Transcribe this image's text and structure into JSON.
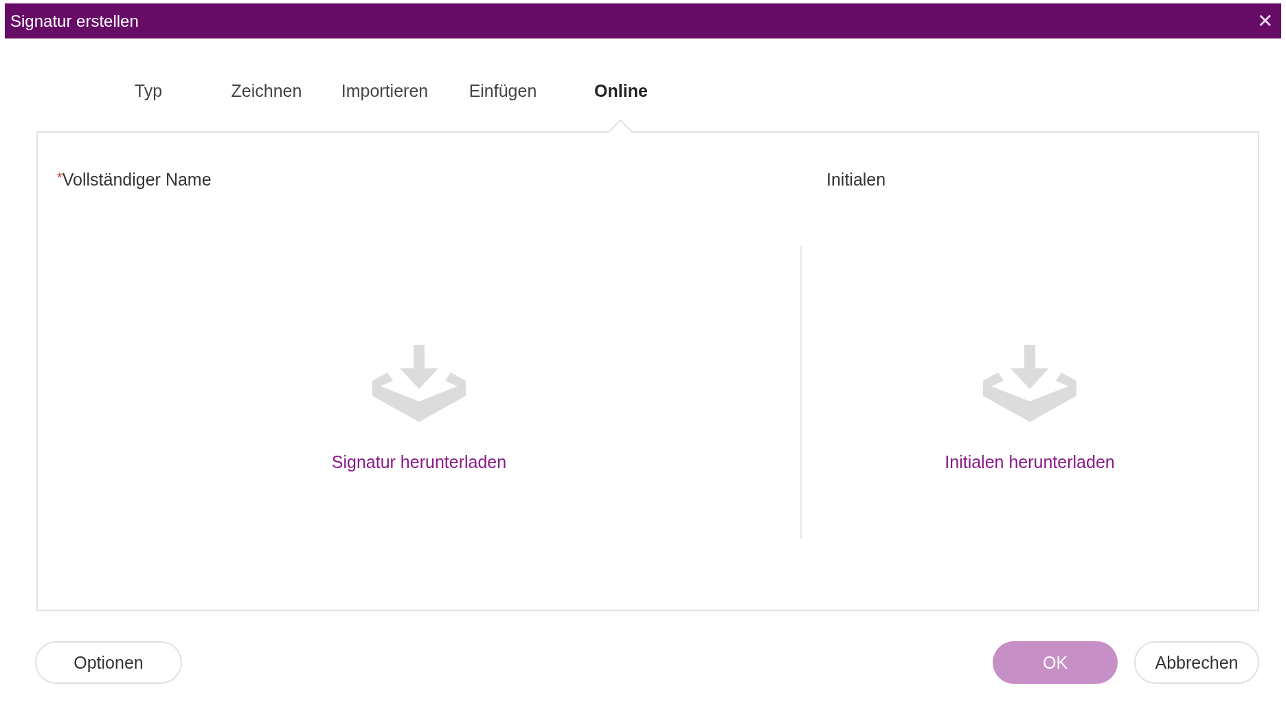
{
  "window": {
    "title": "Signatur erstellen",
    "close": "✕"
  },
  "tabs": [
    {
      "label": "Typ",
      "selected": false
    },
    {
      "label": "Zeichnen",
      "selected": false
    },
    {
      "label": "Importieren",
      "selected": false
    },
    {
      "label": "Einfügen",
      "selected": false
    },
    {
      "label": "Online",
      "selected": true
    }
  ],
  "panels": [
    {
      "marker": "*",
      "label": "Vollständiger Name",
      "link": "Signatur herunterladen"
    },
    {
      "label": "Initialen",
      "link": "Initialen herunterladen"
    }
  ],
  "buttons_left": [
    {
      "label": "Optionen",
      "kind": "secondary",
      "disabled": false
    }
  ],
  "buttons_right": [
    {
      "label": "OK",
      "kind": "primary",
      "disabled": true
    },
    {
      "label": "Abbrechen",
      "kind": "secondary",
      "disabled": false
    }
  ]
}
